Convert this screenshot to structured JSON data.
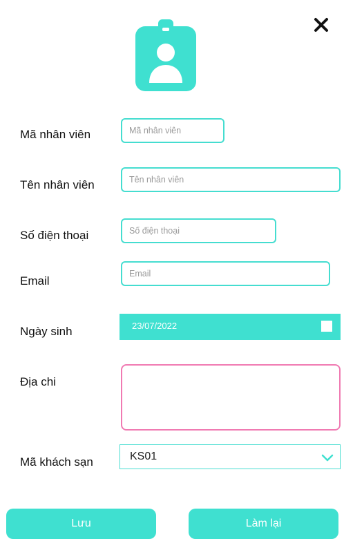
{
  "close": {
    "icon": "close-icon"
  },
  "header": {
    "icon": "id-badge-icon"
  },
  "form": {
    "employee_id": {
      "label": "Mã nhân viên",
      "placeholder": "Mã nhân viên"
    },
    "employee_name": {
      "label": "Tên nhân viên",
      "placeholder": "Tên nhân viên"
    },
    "phone": {
      "label": "Số điện thoại",
      "placeholder": "Số điện thoại"
    },
    "email": {
      "label": "Email",
      "placeholder": "Email"
    },
    "birthdate": {
      "label": "Ngày sinh",
      "value": "23/07/2022"
    },
    "address": {
      "label": "Địa chi"
    },
    "hotel_id": {
      "label": "Mã khách sạn",
      "value": "KS01"
    }
  },
  "buttons": {
    "save": "Lưu",
    "reset": "Làm lại"
  },
  "colors": {
    "accent": "#3fe0d0",
    "address_border": "#f07ab2"
  }
}
